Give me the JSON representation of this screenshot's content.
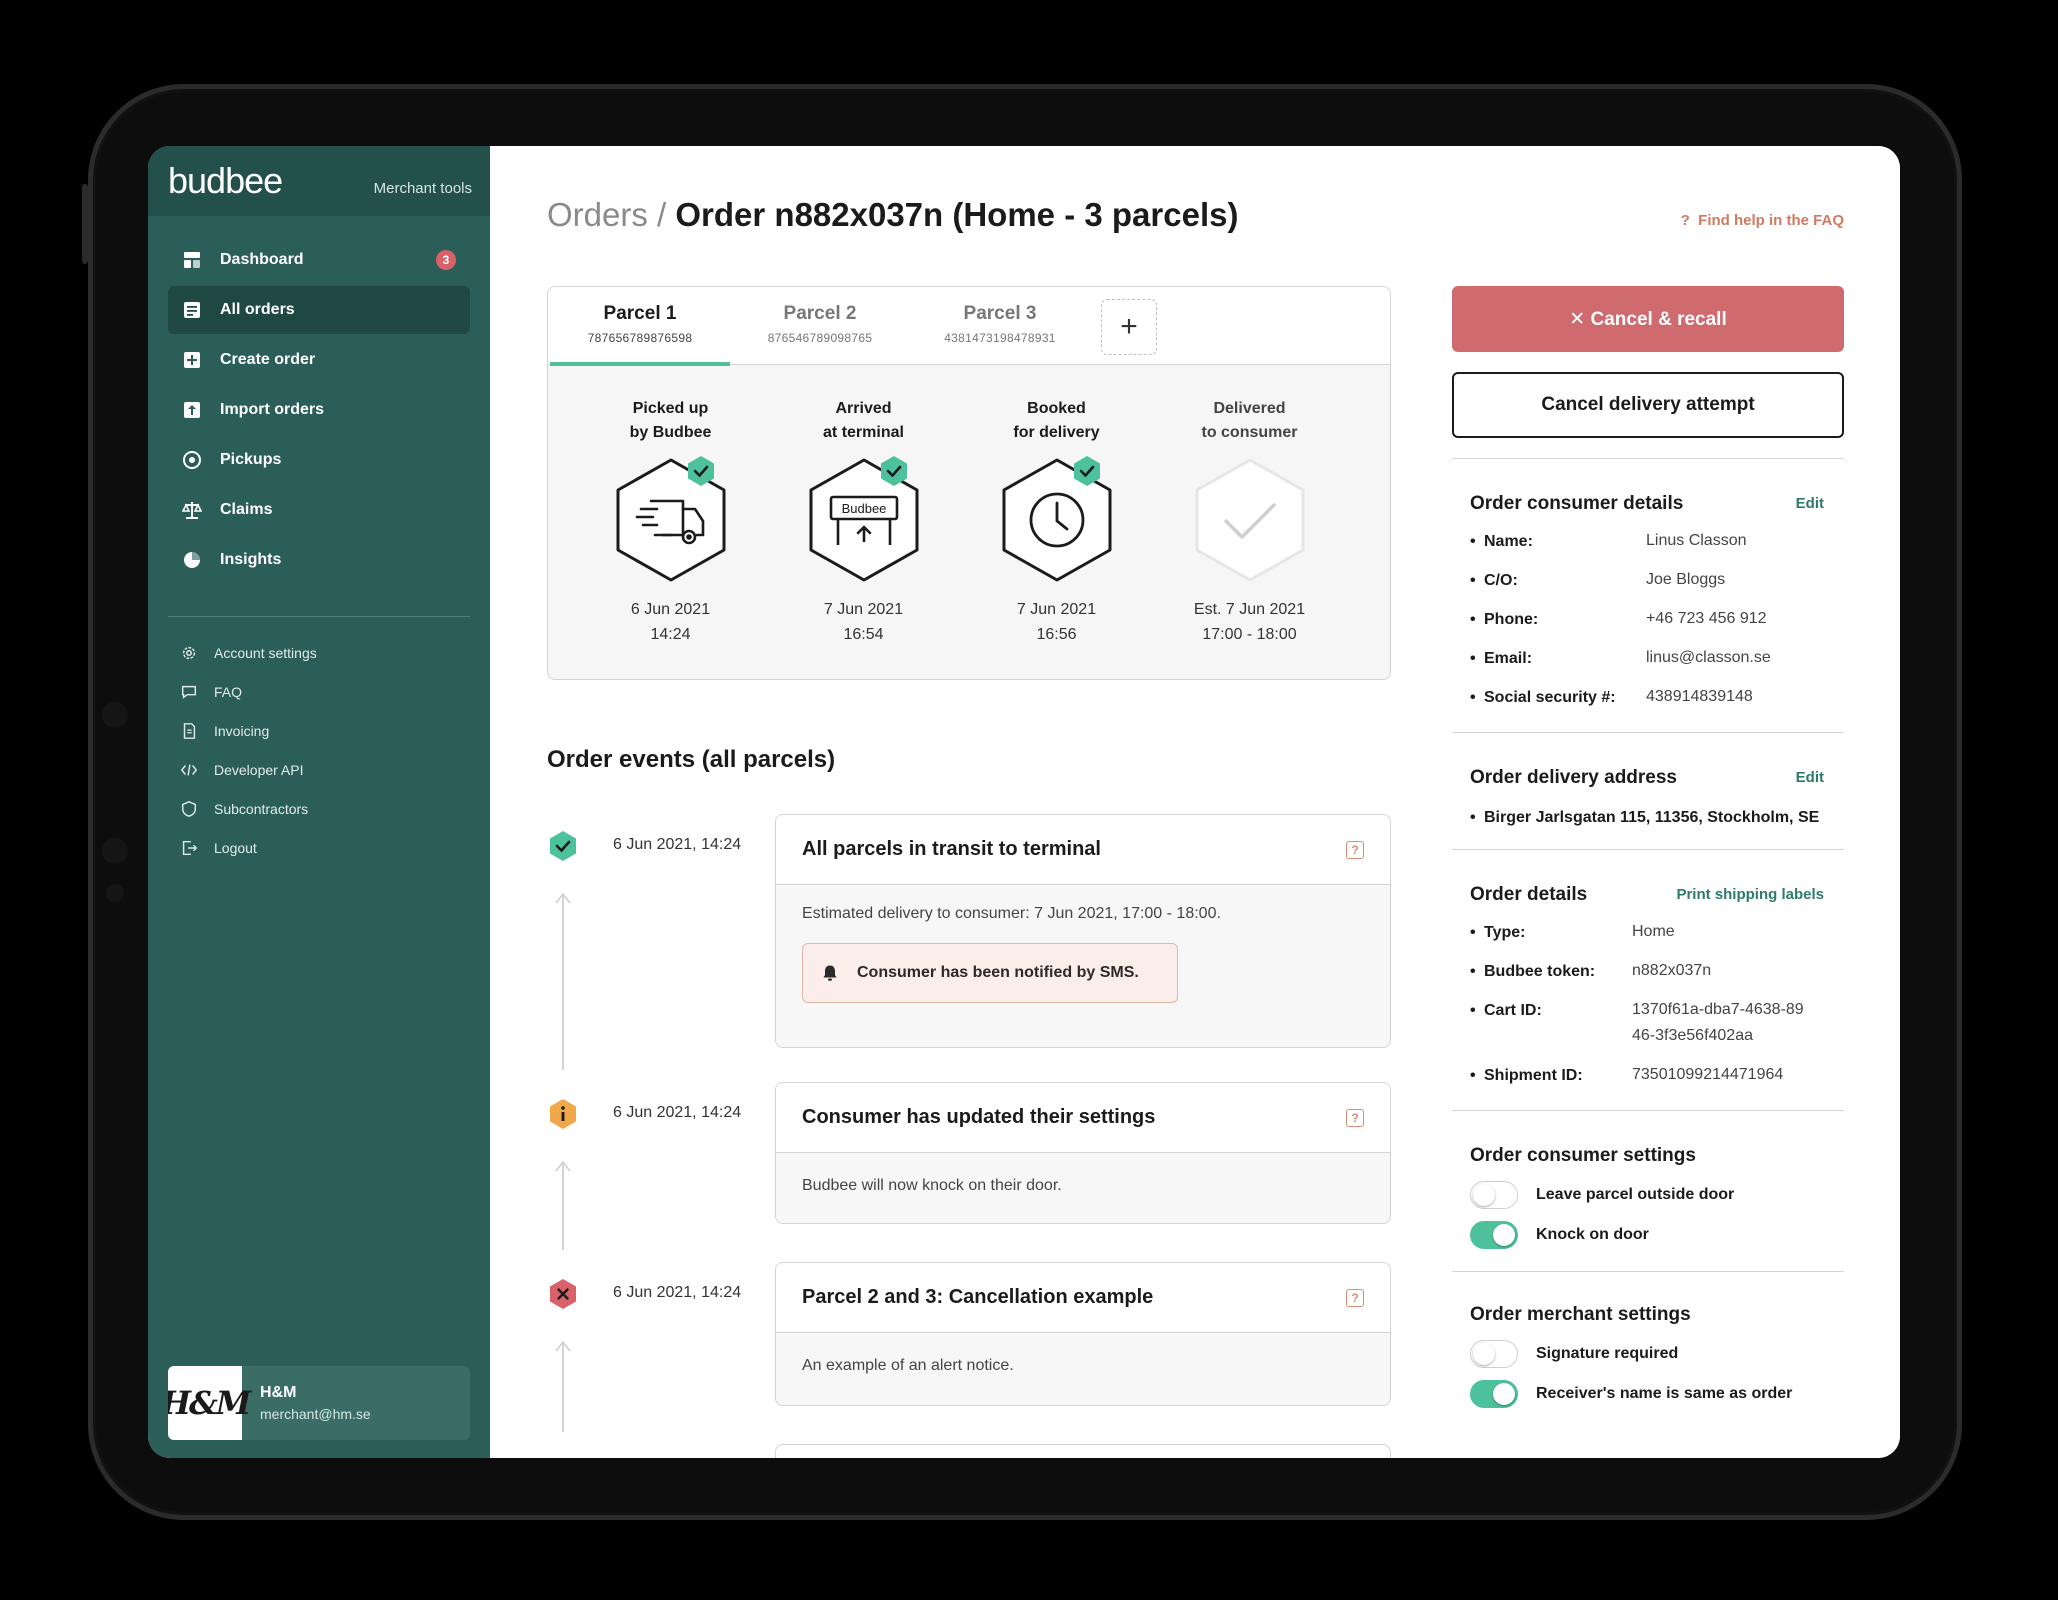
{
  "sidebar": {
    "logo": "budbee",
    "subtitle": "Merchant tools",
    "nav": [
      {
        "label": "Dashboard",
        "icon": "dashboard-icon",
        "badge": "3"
      },
      {
        "label": "All orders",
        "icon": "orders-icon",
        "active": true
      },
      {
        "label": "Create order",
        "icon": "plus-square-icon"
      },
      {
        "label": "Import orders",
        "icon": "upload-icon"
      },
      {
        "label": "Pickups",
        "icon": "pickup-icon"
      },
      {
        "label": "Claims",
        "icon": "scale-icon"
      },
      {
        "label": "Insights",
        "icon": "pie-chart-icon"
      }
    ],
    "sub_nav": [
      {
        "label": "Account settings",
        "icon": "gear-icon"
      },
      {
        "label": "FAQ",
        "icon": "chat-icon"
      },
      {
        "label": "Invoicing",
        "icon": "invoice-icon"
      },
      {
        "label": "Developer API",
        "icon": "code-icon"
      },
      {
        "label": "Subcontractors",
        "icon": "shield-icon"
      },
      {
        "label": "Logout",
        "icon": "logout-icon"
      }
    ],
    "merchant": {
      "logo_text": "H&M",
      "name": "H&M",
      "email": "merchant@hm.se"
    }
  },
  "header": {
    "breadcrumb_root": "Orders",
    "separator": " / ",
    "title": "Order n882x037n (Home - 3 parcels)",
    "faq_link": "Find help in the FAQ",
    "faq_prefix": "?"
  },
  "parcels": {
    "tabs": [
      {
        "label": "Parcel 1",
        "number": "787656789876598",
        "active": true
      },
      {
        "label": "Parcel 2",
        "number": "876546789098765"
      },
      {
        "label": "Parcel 3",
        "number": "4381473198478931"
      }
    ],
    "add_label": "+",
    "steps": [
      {
        "label_1": "Picked up",
        "label_2": "by Budbee",
        "date": "6 Jun 2021",
        "time": "14:24",
        "done": true,
        "icon": "truck-icon"
      },
      {
        "label_1": "Arrived",
        "label_2": "at terminal",
        "date": "7 Jun 2021",
        "time": "16:54",
        "done": true,
        "icon": "terminal-icon",
        "icon_text": "Budbee"
      },
      {
        "label_1": "Booked",
        "label_2": "for delivery",
        "date": "7 Jun 2021",
        "time": "16:56",
        "done": true,
        "icon": "clock-icon"
      },
      {
        "label_1": "Delivered",
        "label_2": "to consumer",
        "date": "Est. 7 Jun 2021",
        "time": "17:00 - 18:00",
        "done": false,
        "icon": "check-icon"
      }
    ]
  },
  "events": {
    "title": "Order events (all parcels)",
    "items": [
      {
        "status": "success",
        "time": "6 Jun 2021, 14:24",
        "title": "All parcels in transit to terminal",
        "body": "Estimated delivery to consumer: 7 Jun 2021, 17:00 - 18:00.",
        "note": "Consumer has been notified by SMS."
      },
      {
        "status": "info",
        "time": "6 Jun 2021, 14:24",
        "title": "Consumer has updated their settings",
        "body": "Budbee will now knock on their door."
      },
      {
        "status": "error",
        "time": "6 Jun 2021, 14:24",
        "title": "Parcel 2 and 3: Cancellation example",
        "body": "An example of an alert notice."
      }
    ],
    "help_glyph": "?"
  },
  "actions": {
    "cancel_recall": "✕ Cancel & recall",
    "cancel_attempt": "Cancel delivery attempt"
  },
  "consumer_details": {
    "title": "Order consumer details",
    "edit": "Edit",
    "rows": [
      {
        "k": "Name:",
        "v": "Linus Classon"
      },
      {
        "k": "C/O:",
        "v": "Joe Bloggs"
      },
      {
        "k": "Phone:",
        "v": "+46 723 456 912"
      },
      {
        "k": "Email:",
        "v": "linus@classon.se"
      },
      {
        "k": "Social security #:",
        "v": "438914839148"
      }
    ]
  },
  "delivery_address": {
    "title": "Order delivery address",
    "edit": "Edit",
    "address": "Birger Jarlsgatan 115, 11356, Stockholm, SE"
  },
  "order_details": {
    "title": "Order details",
    "action": "Print shipping labels",
    "rows": [
      {
        "k": "Type:",
        "v": "Home"
      },
      {
        "k": "Budbee token:",
        "v": "n882x037n"
      },
      {
        "k": "Cart ID:",
        "v": "1370f61a-dba7-4638-8946-3f3e56f402aa"
      },
      {
        "k": "Shipment ID:",
        "v": "73501099214471964"
      }
    ]
  },
  "consumer_settings": {
    "title": "Order consumer settings",
    "toggles": [
      {
        "label": "Leave parcel outside door",
        "on": false
      },
      {
        "label": "Knock on door",
        "on": true
      }
    ]
  },
  "merchant_settings": {
    "title": "Order merchant settings",
    "toggles": [
      {
        "label": "Signature required",
        "on": false
      },
      {
        "label": "Receiver's name is same as order",
        "on": true
      }
    ]
  },
  "colors": {
    "sidebar": "#2b5e58",
    "accent_green": "#4dc19b",
    "danger": "#cf6a6f",
    "warning": "#f0a84a",
    "link": "#2e7a6b"
  }
}
